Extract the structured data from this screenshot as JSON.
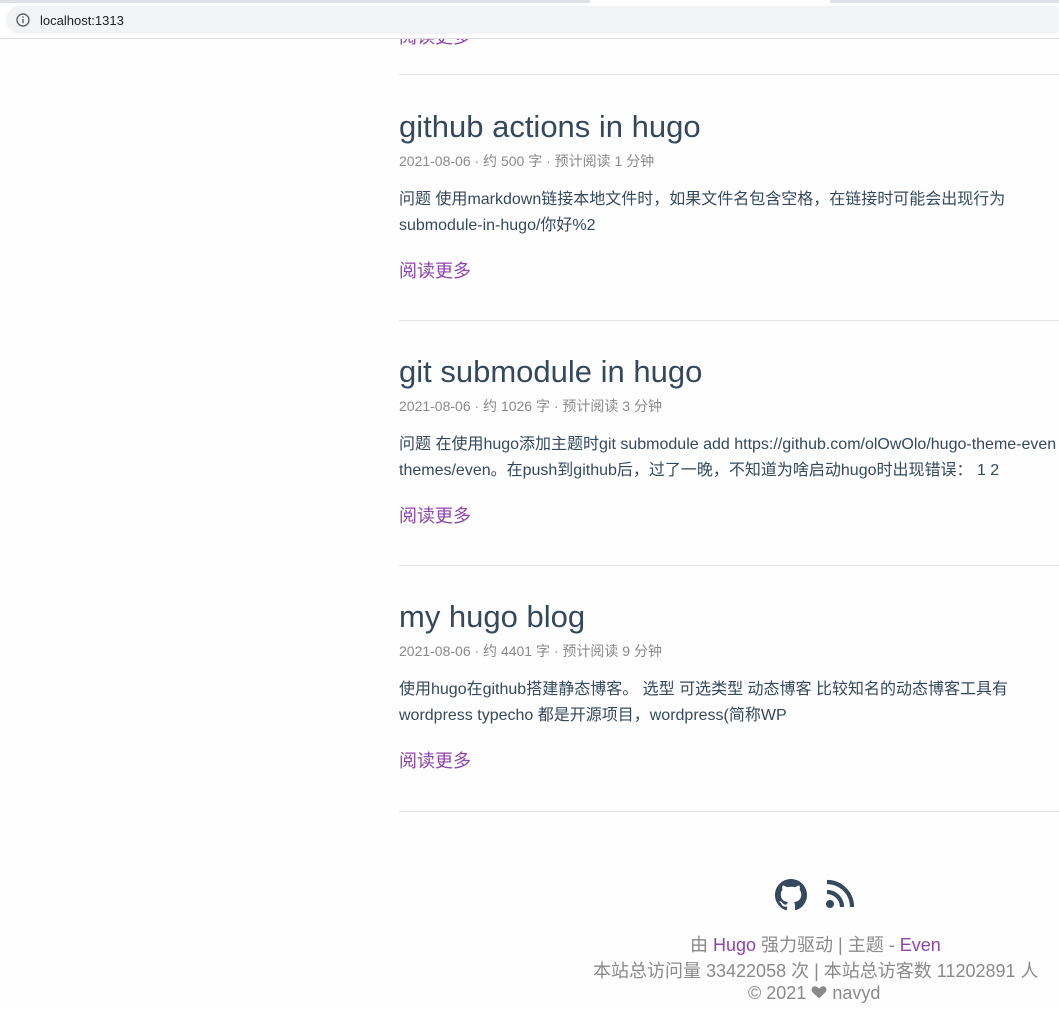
{
  "browser": {
    "url": "localhost:1313"
  },
  "cut_read_more": "阅读更多",
  "posts": [
    {
      "title": "github actions in hugo",
      "meta": "2021-08-06 · 约 500 字 · 预计阅读 1 分钟",
      "summary_line1": "问题 使用markdown链接本地文件时，如果文件名包含空格，在链接时可能会出现行为",
      "summary_line2": "submodule-in-hugo/你好%2",
      "read_more": "阅读更多"
    },
    {
      "title": "git submodule in hugo",
      "meta": "2021-08-06 · 约 1026 字 · 预计阅读 3 分钟",
      "summary_line1": "问题 在使用hugo添加主题时git submodule add https://github.com/olOwOlo/hugo-theme-even",
      "summary_line2": "themes/even。在push到github后，过了一晚，不知道为啥启动hugo时出现错误： 1 2",
      "read_more": "阅读更多"
    },
    {
      "title": "my hugo blog",
      "meta": "2021-08-06 · 约 4401 字 · 预计阅读 9 分钟",
      "summary_line1": "使用hugo在github搭建静态博客。 选型 可选类型 动态博客 比较知名的动态博客工具有",
      "summary_line2": "wordpress typecho 都是开源项目，wordpress(简称WP",
      "read_more": "阅读更多"
    }
  ],
  "footer": {
    "icons": [
      "github-icon",
      "rss-icon"
    ],
    "powered_prefix": "由 ",
    "powered_hugo": "Hugo",
    "powered_middle": " 强力驱动 | 主题 - ",
    "powered_theme": "Even",
    "stats": "本站总访问量 33422058 次 | 本站总访客数 11202891 人",
    "copyright": "© 2021 ",
    "author": " navyd"
  },
  "colors": {
    "link": "#8e44ad",
    "title": "#34495e",
    "meta": "#8a8a8a"
  }
}
